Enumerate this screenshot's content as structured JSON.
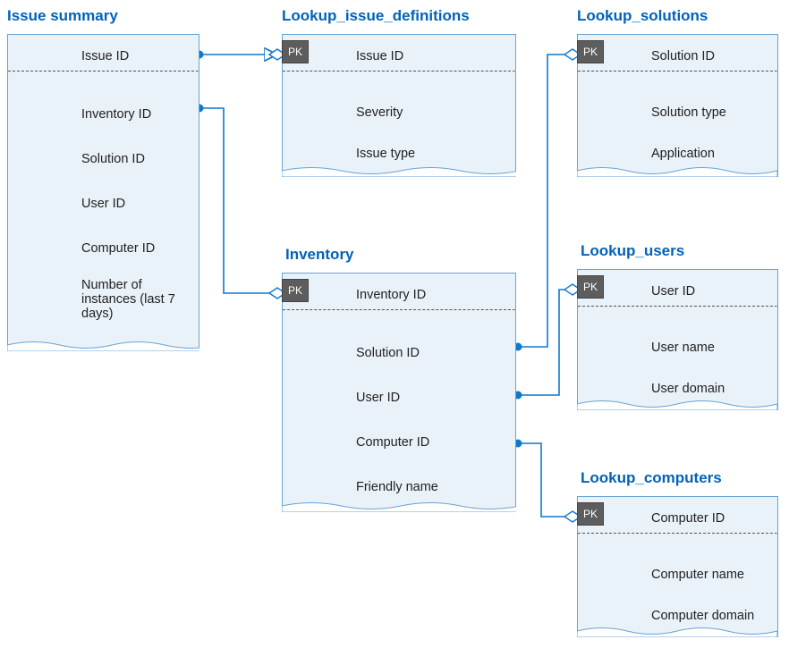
{
  "entities": {
    "issue_summary": {
      "title": "Issue summary",
      "fields": {
        "issue_id": "Issue ID",
        "inventory_id": "Inventory ID",
        "solution_id": "Solution ID",
        "user_id": "User ID",
        "computer_id": "Computer ID",
        "instances": "Number of instances (last 7 days)"
      }
    },
    "lookup_issue_definitions": {
      "title": "Lookup_issue_definitions",
      "pk_label": "PK",
      "fields": {
        "issue_id": "Issue ID",
        "severity": "Severity",
        "issue_type": "Issue type"
      }
    },
    "lookup_solutions": {
      "title": "Lookup_solutions",
      "pk_label": "PK",
      "fields": {
        "solution_id": "Solution ID",
        "solution_type": "Solution type",
        "application": "Application"
      }
    },
    "inventory": {
      "title": "Inventory",
      "pk_label": "PK",
      "fields": {
        "inventory_id": "Inventory ID",
        "solution_id": "Solution ID",
        "user_id": "User ID",
        "computer_id": "Computer ID",
        "friendly_name": "Friendly name"
      }
    },
    "lookup_users": {
      "title": "Lookup_users",
      "pk_label": "PK",
      "fields": {
        "user_id": "User ID",
        "user_name": "User name",
        "user_domain": "User domain"
      }
    },
    "lookup_computers": {
      "title": "Lookup_computers",
      "pk_label": "PK",
      "fields": {
        "computer_id": "Computer ID",
        "computer_name": "Computer name",
        "computer_domain": "Computer domain"
      }
    }
  },
  "relationships": [
    {
      "from": "issue_summary.issue_id",
      "to": "lookup_issue_definitions.issue_id",
      "fk_to_pk": true
    },
    {
      "from": "issue_summary.inventory_id",
      "to": "inventory.inventory_id",
      "fk_to_pk": true
    },
    {
      "from": "inventory.solution_id",
      "to": "lookup_solutions.solution_id",
      "fk_to_pk": true
    },
    {
      "from": "inventory.user_id",
      "to": "lookup_users.user_id",
      "fk_to_pk": true
    },
    {
      "from": "inventory.computer_id",
      "to": "lookup_computers.computer_id",
      "fk_to_pk": true
    }
  ],
  "colors": {
    "entity_border": "#69a3d4",
    "entity_fill": "#e9f2f9",
    "title": "#0262b8",
    "connector": "#1177cc",
    "pk_badge_bg": "#5d5d5d"
  }
}
